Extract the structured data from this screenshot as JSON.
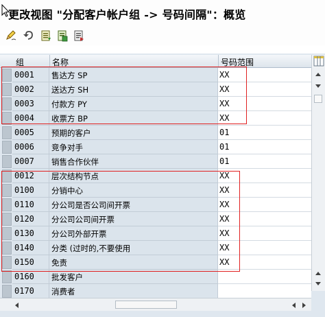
{
  "window": {
    "title": "更改视图 \"分配客户帐户组 -> 号码间隔\"：概览"
  },
  "toolbar": {
    "icons": [
      "edit-pencil-icon",
      "undo-icon",
      "save-document-icon",
      "copy-document-icon",
      "details-document-icon"
    ]
  },
  "table": {
    "columns": [
      "组",
      "名称",
      "号码范围"
    ],
    "rows": [
      {
        "group": "0001",
        "name": "售达方 SP",
        "range": "XX"
      },
      {
        "group": "0002",
        "name": "送达方 SH",
        "range": "XX"
      },
      {
        "group": "0003",
        "name": "付款方 PY",
        "range": "XX"
      },
      {
        "group": "0004",
        "name": "收票方 BP",
        "range": "XX"
      },
      {
        "group": "0005",
        "name": "预期的客户",
        "range": "01"
      },
      {
        "group": "0006",
        "name": "竞争对手",
        "range": "01"
      },
      {
        "group": "0007",
        "name": "销售合作伙伴",
        "range": "01"
      },
      {
        "group": "0012",
        "name": "层次结构节点",
        "range": "XX"
      },
      {
        "group": "0100",
        "name": "分销中心",
        "range": "XX"
      },
      {
        "group": "0110",
        "name": "分公司是否公司间开票",
        "range": "XX"
      },
      {
        "group": "0120",
        "name": "分公司公司间开票",
        "range": "XX"
      },
      {
        "group": "0130",
        "name": "分公司外部开票",
        "range": "XX"
      },
      {
        "group": "0140",
        "name": "分类 (过时的,不要使用",
        "range": "XX"
      },
      {
        "group": "0150",
        "name": "免责",
        "range": "XX"
      },
      {
        "group": "0160",
        "name": "批发客户",
        "range": ""
      },
      {
        "group": "0170",
        "name": "消费者",
        "range": ""
      }
    ]
  },
  "colors": {
    "highlight_box": "#e02020",
    "key_column_bg": "#dbe4ec",
    "panel_bg": "#dfe7ef"
  }
}
